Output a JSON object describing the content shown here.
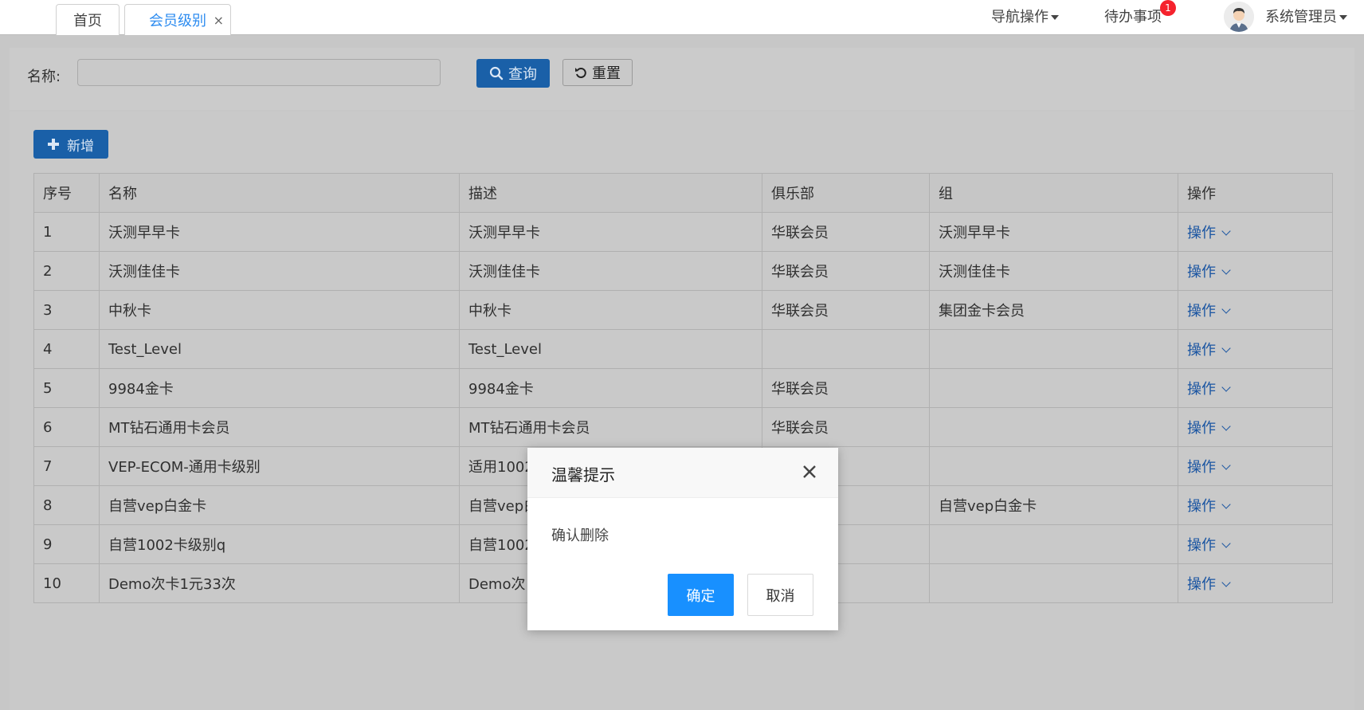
{
  "tabs": [
    {
      "label": "首页"
    },
    {
      "label": "会员级别",
      "close": "×"
    }
  ],
  "header": {
    "nav_ops": "导航操作",
    "todo": "待办事项",
    "todo_badge": "1",
    "username": "系统管理员"
  },
  "filter": {
    "name_label": "名称:",
    "name_value": "",
    "query_label": "查询",
    "reset_label": "重置"
  },
  "toolbar": {
    "add_label": "新增"
  },
  "table": {
    "columns": [
      "序号",
      "名称",
      "描述",
      "俱乐部",
      "组",
      "操作"
    ],
    "rows": [
      {
        "no": "1",
        "name": "沃测早早卡",
        "desc": "沃测早早卡",
        "club": "华联会员",
        "group": "沃测早早卡",
        "op": "操作"
      },
      {
        "no": "2",
        "name": "沃测佳佳卡",
        "desc": "沃测佳佳卡",
        "club": "华联会员",
        "group": "沃测佳佳卡",
        "op": "操作"
      },
      {
        "no": "3",
        "name": "中秋卡",
        "desc": "中秋卡",
        "club": "华联会员",
        "group": "集团金卡会员",
        "op": "操作"
      },
      {
        "no": "4",
        "name": "Test_Level",
        "desc": "Test_Level",
        "club": "",
        "group": "",
        "op": "操作"
      },
      {
        "no": "5",
        "name": "9984金卡",
        "desc": "9984金卡",
        "club": "华联会员",
        "group": "",
        "op": "操作"
      },
      {
        "no": "6",
        "name": "MT钻石通用卡会员",
        "desc": "MT钻石通用卡会员",
        "club": "华联会员",
        "group": "",
        "op": "操作"
      },
      {
        "no": "7",
        "name": "VEP-ECOM-通用卡级别",
        "desc": "适用1002",
        "club": "",
        "group": "",
        "op": "操作"
      },
      {
        "no": "8",
        "name": "自营vep白金卡",
        "desc": "自营vep白",
        "club": "",
        "group": "自营vep白金卡",
        "op": "操作"
      },
      {
        "no": "9",
        "name": "自营1002卡级别q",
        "desc": "自营1002",
        "club": "",
        "group": "",
        "op": "操作"
      },
      {
        "no": "10",
        "name": "Demo次卡1元33次",
        "desc": "Demo次",
        "club": "",
        "group": "",
        "op": "操作"
      }
    ]
  },
  "modal": {
    "title": "温馨提示",
    "message": "确认删除",
    "ok_label": "确定",
    "cancel_label": "取消"
  },
  "colors": {
    "primary": "#1890ff",
    "link": "#2d8cf0",
    "badge": "#f5222d"
  }
}
